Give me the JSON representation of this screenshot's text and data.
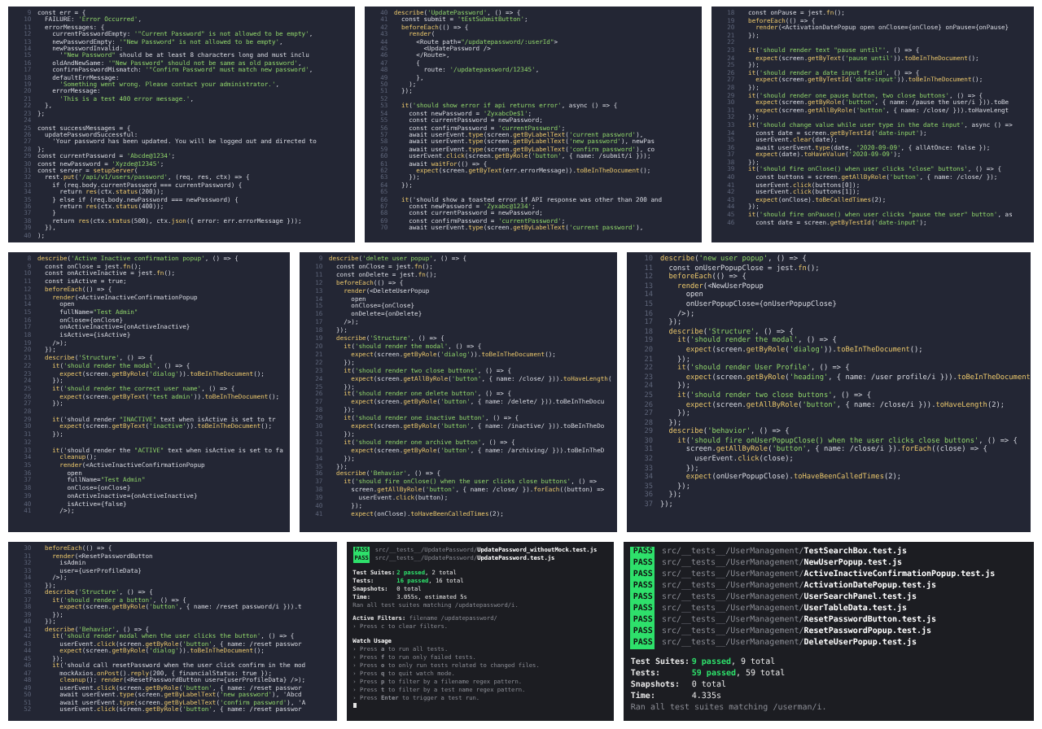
{
  "rows": [
    {
      "panels": [
        {
          "kind": "code",
          "lines": [
            [
              "9",
              "const err = {"
            ],
            [
              "10",
              "  FAILURE: 'Error Occurred',"
            ],
            [
              "11",
              "  errorMessages: {"
            ],
            [
              "12",
              "    currentPasswordEmpty: '\"Current Password\" is not allowed to be empty',"
            ],
            [
              "13",
              "    newPasswordEmpty: '\"New Password\" is not allowed to be empty',"
            ],
            [
              "14",
              "    newPasswordInvalid:"
            ],
            [
              "15",
              "      '\"New Password\" should be at least 8 characters long and must inclu"
            ],
            [
              "16",
              "    oldAndNewSame: '\"New Password\" should not be same as old password',"
            ],
            [
              "17",
              "    confirmPasswordMismatch: '\"Confirm Password\" must match new password',"
            ],
            [
              "18",
              "    defaultErrMessage:"
            ],
            [
              "19",
              "      'Something went wrong. Please contact your administrator.',"
            ],
            [
              "20",
              "    errorMessage:"
            ],
            [
              "21",
              "      'This is a test 400 error message.',"
            ],
            [
              "22",
              "  },"
            ],
            [
              "23",
              "};"
            ],
            [
              "24"
            ],
            [
              "25",
              "const successMessages = {"
            ],
            [
              "26",
              "  updatePasswordSuccessful:"
            ],
            [
              "27",
              "    'Your password has been updated. You will be logged out and directed to"
            ],
            [
              "28",
              "};"
            ],
            [
              "29",
              "const currentPassword = 'Abcde@1234';"
            ],
            [
              "30",
              "const newPassword = 'Xyzde@12345';"
            ],
            [
              "31",
              "const server = setupServer("
            ],
            [
              "32",
              "  rest.put('/api/v1/users/password', (req, res, ctx) => {"
            ],
            [
              "33",
              "    if (req.body.currentPassword === currentPassword) {"
            ],
            [
              "34",
              "      return res(ctx.status(200));"
            ],
            [
              "35",
              "    } else if (req.body.newPassword === newPassword) {"
            ],
            [
              "36",
              "      return res(ctx.status(400));"
            ],
            [
              "37",
              "    }"
            ],
            [
              "38",
              "    return res(ctx.status(500), ctx.json({ error: err.errorMessage }));"
            ],
            [
              "39",
              "  }),"
            ],
            [
              "40",
              ");"
            ]
          ]
        },
        {
          "kind": "code",
          "lines": [
            [
              "40",
              "describe('UpdatePassword', () => {"
            ],
            [
              "41",
              "  const submit = 'tEstSubmitButton';"
            ],
            [
              "42",
              "  beforeEach(() => {"
            ],
            [
              "43",
              "    render("
            ],
            [
              "44",
              "      <Route path=\"/updatepassword/:userId\">"
            ],
            [
              "45",
              "        <UpdatePassword />"
            ],
            [
              "46",
              "      </Route>,"
            ],
            [
              "47",
              "      {"
            ],
            [
              "48",
              "        route: '/updatepassword/12345',"
            ],
            [
              "49",
              "      },"
            ],
            [
              "50",
              "    );"
            ],
            [
              "51",
              "  });"
            ],
            [
              "52"
            ],
            [
              "53",
              "  it('should show error if api returns error', async () => {"
            ],
            [
              "54",
              "    const newPassword = 'ZyxabcDe$1';"
            ],
            [
              "55",
              "    const currentPassword = newPassword;"
            ],
            [
              "56",
              "    const confirmPassword = 'currentPassword';"
            ],
            [
              "57",
              "    await userEvent.type(screen.getByLabelText('current password'),"
            ],
            [
              "58",
              "    await userEvent.type(screen.getByLabelText('new password'), newPas"
            ],
            [
              "59",
              "    await userEvent.type(screen.getByLabelText('confirm password'), co"
            ],
            [
              "60",
              "    userEvent.click(screen.getByRole('button', { name: /submit/i }));"
            ],
            [
              "61",
              "    await waitFor(() => {"
            ],
            [
              "62",
              "      expect(screen.getByText(err.errorMessage)).toBeInTheDocument();"
            ],
            [
              "63",
              "    });"
            ],
            [
              "64",
              "  });"
            ],
            [
              "65"
            ],
            [
              "66",
              "  it('should show a toasted error if API response was other than 200 and"
            ],
            [
              "67",
              "    const newPassword = 'Zyxabc@1234';"
            ],
            [
              "68",
              "    const currentPassword = newPassword;"
            ],
            [
              "69",
              "    const confirmPassword = 'currentPassword';"
            ],
            [
              "70",
              "    await userEvent.type(screen.getByLabelText('current password'),"
            ]
          ]
        },
        {
          "kind": "code",
          "lines": [
            [
              "18",
              "  const onPause = jest.fn();"
            ],
            [
              "19",
              "  beforeEach(() => {"
            ],
            [
              "20",
              "    render(<ActivationDatePopup open onClose={onClose} onPause={onPause}"
            ],
            [
              "21",
              "  });"
            ],
            [
              "22"
            ],
            [
              "23",
              "  it('should render text \"pause until\"', () => {"
            ],
            [
              "24",
              "    expect(screen.getByText('pause until')).toBeInTheDocument();"
            ],
            [
              "25",
              "  });"
            ],
            [
              "26",
              "  it('should render a date input field', () => {"
            ],
            [
              "27",
              "    expect(screen.getByTestId('date-input')).toBeInTheDocument();"
            ],
            [
              "28",
              "  });"
            ],
            [
              "29",
              "  it('should render one pause button, two close buttons', () => {"
            ],
            [
              "30",
              "    expect(screen.getByRole('button', { name: /pause the user/i })).toBe"
            ],
            [
              "31",
              "    expect(screen.getAllByRole('button', { name: /close/ })).toHaveLengt"
            ],
            [
              "32",
              "  });"
            ],
            [
              "33",
              "  it('should change value while user type in the date input', async () =>"
            ],
            [
              "34",
              "    const date = screen.getByTestId('date-input');"
            ],
            [
              "35",
              "    userEvent.clear(date);"
            ],
            [
              "36",
              "    await userEvent.type(date, '2020-09-09', { allAtOnce: false });"
            ],
            [
              "37",
              "    expect(date).toHaveValue('2020-09-09');"
            ],
            [
              "38",
              "  });"
            ],
            [
              "39",
              "  it('should fire onClose() when user clicks \"close\" buttons', () => {"
            ],
            [
              "40",
              "    const buttons = screen.getAllByRole('button', { name: /close/ });"
            ],
            [
              "41",
              "    userEvent.click(buttons[0]);"
            ],
            [
              "42",
              "    userEvent.click(buttons[1]);"
            ],
            [
              "43",
              "    expect(onClose).toBeCalledTimes(2);"
            ],
            [
              "44",
              "  });"
            ],
            [
              "45",
              "  it('should fire onPause() when user clicks \"pause the user\" button', as"
            ],
            [
              "46",
              "    const date = screen.getByTestId('date-input');"
            ]
          ]
        }
      ]
    },
    {
      "panels": [
        {
          "kind": "code",
          "lines": [
            [
              "8",
              "describe('Active Inactive confirmation popup', () => {"
            ],
            [
              "9",
              "  const onClose = jest.fn();"
            ],
            [
              "10",
              "  const onActiveInactive = jest.fn();"
            ],
            [
              "11",
              "  const isActive = true;"
            ],
            [
              "12",
              "  beforeEach(() => {"
            ],
            [
              "13",
              "    render(<ActiveInactiveConfirmationPopup"
            ],
            [
              "14",
              "      open"
            ],
            [
              "15",
              "      fullName=\"Test Admin\""
            ],
            [
              "16",
              "      onClose={onClose}"
            ],
            [
              "17",
              "      onActiveInactive={onActiveInactive}"
            ],
            [
              "18",
              "      isActive={isActive}"
            ],
            [
              "19",
              "    />);"
            ],
            [
              "20",
              "  });"
            ],
            [
              "21",
              "  describe('Structure', () => {"
            ],
            [
              "22",
              "    it('should render the modal', () => {"
            ],
            [
              "23",
              "      expect(screen.getByRole('dialog')).toBeInTheDocument();"
            ],
            [
              "24",
              "    });"
            ],
            [
              "25",
              "    it('should render the correct user name', () => {"
            ],
            [
              "26",
              "      expect(screen.getByText('test admin')).toBeInTheDocument();"
            ],
            [
              "27",
              "    });"
            ],
            [
              "28"
            ],
            [
              "29",
              "    it('should render \"INACTIVE\" text when isActive is set to tr"
            ],
            [
              "30",
              "      expect(screen.getByText('inactive')).toBeInTheDocument();"
            ],
            [
              "31",
              "    });"
            ],
            [
              "32"
            ],
            [
              "33",
              "    it('should render the \"ACTIVE\" text when isActive is set to fa"
            ],
            [
              "34",
              "      cleanup();"
            ],
            [
              "35",
              "      render(<ActiveInactiveConfirmationPopup"
            ],
            [
              "36",
              "        open"
            ],
            [
              "37",
              "        fullName=\"Test Admin\""
            ],
            [
              "38",
              "        onClose={onClose}"
            ],
            [
              "39",
              "        onActiveInactive={onActiveInactive}"
            ],
            [
              "40",
              "        isActive={false}"
            ],
            [
              "41",
              "      />);"
            ]
          ]
        },
        {
          "kind": "code",
          "lines": [
            [
              "9",
              "describe('delete user popup', () => {"
            ],
            [
              "10",
              "  const onClose = jest.fn();"
            ],
            [
              "11",
              "  const onDelete = jest.fn();"
            ],
            [
              "12",
              "  beforeEach(() => {"
            ],
            [
              "13",
              "    render(<DeleteUserPopup"
            ],
            [
              "14",
              "      open"
            ],
            [
              "15",
              "      onClose={onClose}"
            ],
            [
              "16",
              "      onDelete={onDelete}"
            ],
            [
              "17",
              "    />);"
            ],
            [
              "18",
              "  });"
            ],
            [
              "19",
              "  describe('Structure', () => {"
            ],
            [
              "20",
              "    it('should render the modal', () => {"
            ],
            [
              "21",
              "      expect(screen.getByRole('dialog')).toBeInTheDocument();"
            ],
            [
              "22",
              "    });"
            ],
            [
              "23",
              "    it('should render two close buttons', () => {"
            ],
            [
              "24",
              "      expect(screen.getAllByRole('button', { name: /close/ })).toHaveLength("
            ],
            [
              "25",
              "    });"
            ],
            [
              "26",
              "    it('should render one delete button', () => {"
            ],
            [
              "27",
              "      expect(screen.getByRole('button', { name: /delete/ })).toBeInTheDocu"
            ],
            [
              "28",
              "    });"
            ],
            [
              "29",
              "    it('should render one inactive button', () => {"
            ],
            [
              "30",
              "      expect(screen.getByRole('button', { name: /inactive/ })).toBeInTheDo"
            ],
            [
              "31",
              "    });"
            ],
            [
              "32",
              "    it('should render one archive button', () => {"
            ],
            [
              "33",
              "      expect(screen.getByRole('button', { name: /archiving/ })).toBeInTheD"
            ],
            [
              "34",
              "    });"
            ],
            [
              "35",
              "  });"
            ],
            [
              "36",
              "  describe('Behavior', () => {"
            ],
            [
              "37",
              "    it('should fire onClose() when the user clicks close buttons', () =>"
            ],
            [
              "38",
              "      screen.getAllByRole('button', { name: /close/ }).forEach((button) =>"
            ],
            [
              "39",
              "        userEvent.click(button);"
            ],
            [
              "40",
              "      });"
            ],
            [
              "41",
              "      expect(onClose).toHaveBeenCalledTimes(2);"
            ]
          ]
        },
        {
          "kind": "code",
          "lines": [
            [
              "10",
              "describe('new user popup', () => {"
            ],
            [
              "11",
              "  const onUserPopupClose = jest.fn();"
            ],
            [
              "12",
              "  beforeEach(() => {"
            ],
            [
              "13",
              "    render(<NewUserPopup"
            ],
            [
              "14",
              "      open"
            ],
            [
              "15",
              "      onUserPopupClose={onUserPopupClose}"
            ],
            [
              "16",
              "    />);"
            ],
            [
              "17",
              "  });"
            ],
            [
              "18",
              "  describe('Structure', () => {"
            ],
            [
              "19",
              "    it('should render the modal', () => {"
            ],
            [
              "20",
              "      expect(screen.getByRole('dialog')).toBeInTheDocument();"
            ],
            [
              "21",
              "    });"
            ],
            [
              "22",
              "    it('should render User Profile', () => {"
            ],
            [
              "23",
              "      expect(screen.getByRole('heading', { name: /user profile/i })).toBeInTheDocument();"
            ],
            [
              "24",
              "    });"
            ],
            [
              "25",
              "    it('should render two close buttons', () => {"
            ],
            [
              "26",
              "      expect(screen.getAllByRole('button', { name: /close/i })).toHaveLength(2);"
            ],
            [
              "27",
              "    });"
            ],
            [
              "28",
              "  });"
            ],
            [
              "29",
              "  describe('behavior', () => {"
            ],
            [
              "30",
              "    it('should fire onUserPopupClose() when the user clicks close buttons', () => {"
            ],
            [
              "31",
              "      screen.getAllByRole('button', { name: /close/i }).forEach((close) => {"
            ],
            [
              "32",
              "        userEvent.click(close);"
            ],
            [
              "33",
              "      });"
            ],
            [
              "34",
              "      expect(onUserPopupClose).toHaveBeenCalledTimes(2);"
            ],
            [
              "35",
              "    });"
            ],
            [
              "36",
              "  });"
            ],
            [
              "37",
              "});"
            ]
          ]
        }
      ]
    },
    {
      "panels": [
        {
          "kind": "code",
          "lines": [
            [
              "30",
              "  beforeEach(() => {"
            ],
            [
              "31",
              "    render(<ResetPasswordButton"
            ],
            [
              "32",
              "      isAdmin"
            ],
            [
              "33",
              "      user={userProfileData}"
            ],
            [
              "34",
              "    />);"
            ],
            [
              "35",
              "  });"
            ],
            [
              "36",
              "  describe('Structure', () => {"
            ],
            [
              "37",
              "    it('should render a button', () => {"
            ],
            [
              "38",
              "      expect(screen.getByRole('button', { name: /reset password/i })).t"
            ],
            [
              "39",
              "    });"
            ],
            [
              "40",
              "  });"
            ],
            [
              "41",
              "  describe('Behavior', () => {"
            ],
            [
              "42",
              "    it('should render modal when the user clicks the button', () => {"
            ],
            [
              "43",
              "      userEvent.click(screen.getByRole('button', { name: /reset passwor"
            ],
            [
              "44",
              "      expect(screen.getByRole('dialog')).toBeInTheDocument();"
            ],
            [
              "45",
              "    });"
            ],
            [
              "46",
              "    it('should call resetPassword when the user click confirm in the mod"
            ],
            [
              "47",
              "      mockAxios.onPost().reply(200, { financialStatus: true });"
            ],
            [
              "48",
              "      cleanup(); render(<ResetPasswordButton user={userProfileData} />);"
            ],
            [
              "49",
              "      userEvent.click(screen.getByRole('button', { name: /reset passwor"
            ],
            [
              "50",
              "      await userEvent.type(screen.getByLabelText('new password'), 'Abcd"
            ],
            [
              "51",
              "      await userEvent.type(screen.getByLabelText('confirm password'), 'A"
            ],
            [
              "52",
              "      userEvent.click(screen.getByRole('button', { name: /reset passwor"
            ]
          ]
        },
        {
          "kind": "terminal",
          "results": [
            {
              "status": "PASS",
              "dir": "src/__tests__/UpdatePassword/",
              "file": "UpdatePassword_withoutMock.test.js"
            },
            {
              "status": "PASS",
              "dir": "src/__tests__/UpdatePassword/",
              "file": "UpdatePassword.test.js"
            }
          ],
          "summary": [
            {
              "label": "Test Suites:",
              "highlight": "2 passed",
              "rest": ", 2 total"
            },
            {
              "label": "Tests:",
              "highlight": "16 passed",
              "rest": ", 16 total"
            },
            {
              "label": "Snapshots:",
              "rest": "0 total"
            },
            {
              "label": "Time:",
              "rest": "3.055s, estimated 5s"
            }
          ],
          "footer": "Ran all test suites matching /updatepassword/i.",
          "filters": {
            "label": "Active Filters:",
            "text": "filename /updatepassword/"
          },
          "filter_hint": "› Press c to clear filters.",
          "usage_title": "Watch Usage",
          "usage": [
            "› Press **a** to run all tests.",
            "› Press **f** to run only failed tests.",
            "› Press **o** to only run tests related to changed files.",
            "› Press **q** to quit watch mode.",
            "› Press **p** to filter by a filename regex pattern.",
            "› Press **t** to filter by a test name regex pattern.",
            "› Press **Enter** to trigger a test run."
          ]
        },
        {
          "kind": "terminal",
          "results": [
            {
              "status": "PASS",
              "dir": "src/__tests__/UserManagement/",
              "file": "TestSearchBox.test.js"
            },
            {
              "status": "PASS",
              "dir": "src/__tests__/UserManagement/",
              "file": "NewUserPopup.test.js"
            },
            {
              "status": "PASS",
              "dir": "src/__tests__/UserManagement/",
              "file": "ActiveInactiveConfirmationPopup.test.js"
            },
            {
              "status": "PASS",
              "dir": "src/__tests__/UserManagement/",
              "file": "ActivationDatePopup.test.js"
            },
            {
              "status": "PASS",
              "dir": "src/__tests__/UserManagement/",
              "file": "UserSearchPanel.test.js"
            },
            {
              "status": "PASS",
              "dir": "src/__tests__/UserManagement/",
              "file": "UserTableData.test.js"
            },
            {
              "status": "PASS",
              "dir": "src/__tests__/UserManagement/",
              "file": "ResetPasswordButton.test.js"
            },
            {
              "status": "PASS",
              "dir": "src/__tests__/UserManagement/",
              "file": "ResetPasswordPopup.test.js"
            },
            {
              "status": "PASS",
              "dir": "src/__tests__/UserManagement/",
              "file": "DeleteUserPopup.test.js"
            }
          ],
          "summary": [
            {
              "label": "Test Suites:",
              "highlight": "9 passed",
              "rest": ", 9 total"
            },
            {
              "label": "Tests:",
              "highlight": "59 passed",
              "rest": ", 59 total"
            },
            {
              "label": "Snapshots:",
              "rest": "0 total"
            },
            {
              "label": "Time:",
              "rest": "4.335s"
            }
          ],
          "footer": "Ran all test suites matching /userman/i."
        }
      ]
    }
  ]
}
